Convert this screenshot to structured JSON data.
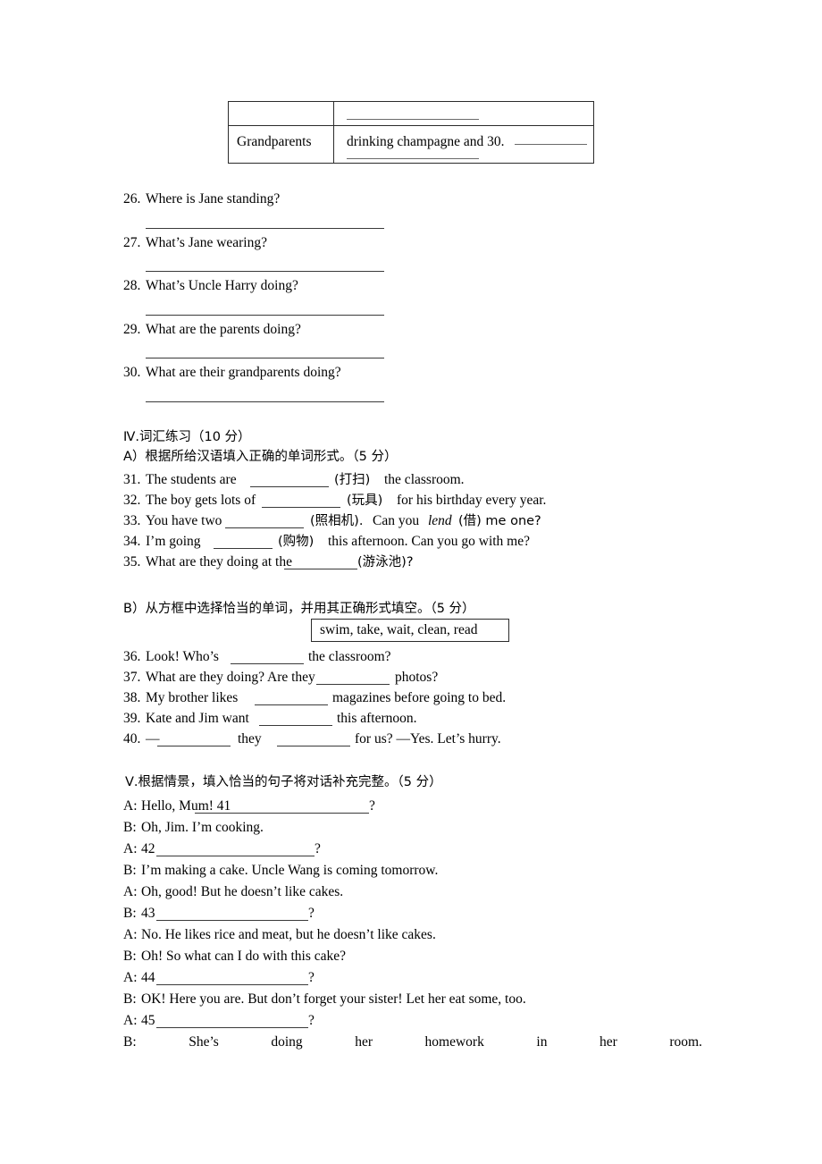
{
  "document": {
    "type": "english-exam-worksheet-page",
    "language": "English / Chinese"
  },
  "table": {
    "rows": [
      {
        "label": "",
        "content": ""
      },
      {
        "label": "Grandparents",
        "content": "drinking champagne and 30."
      }
    ]
  },
  "picture_questions": [
    {
      "number": "26.",
      "text": "Where is Jane standing?"
    },
    {
      "number": "27.",
      "text": "What’s Jane wearing?"
    },
    {
      "number": "28.",
      "text": "What’s Uncle Harry doing?"
    },
    {
      "number": "29.",
      "text": "What are the parents doing?"
    },
    {
      "number": "30.",
      "text": "What are their grandparents doing?"
    }
  ],
  "section_iv": {
    "heading": "Ⅳ.词汇练习（10 分）",
    "part_a": {
      "heading": "A）根据所给汉语填入正确的单词形式。（5 分）",
      "items": [
        {
          "number": "31.",
          "before": "The students are",
          "hint": "(打扫)",
          "after": "the classroom."
        },
        {
          "number": "32.",
          "before": "The boy gets lots of",
          "hint": "(玩具)",
          "after": "for his birthday every year."
        },
        {
          "number": "33.",
          "before": "You have two",
          "hint": "(照相机).",
          "after": "Can you lend(借) me one?"
        },
        {
          "number": "34.",
          "before": "I’m going",
          "hint": "(购物)",
          "after": "this afternoon. Can you go with me?"
        },
        {
          "number": "35.",
          "before": "What are they doing at the",
          "hint": "(游泳池)?",
          "after": ""
        }
      ],
      "q33_parts": {
        "a": "Can you ",
        "b": "lend",
        "c": "(借) me one?"
      }
    },
    "part_b": {
      "heading": "B）从方框中选择恰当的单词，并用其正确形式填空。（5 分）",
      "word_bank": "swim, take, wait, clean, read",
      "items": [
        {
          "number": "36.",
          "before": "Look! Who’s",
          "after": "the classroom?"
        },
        {
          "number": "37.",
          "before": "What are they doing? Are they",
          "after": "photos?"
        },
        {
          "number": "38.",
          "before": "My brother likes",
          "after": "magazines before going to bed."
        },
        {
          "number": "39.",
          "before": "Kate and Jim want",
          "after": "this afternoon."
        },
        {
          "number": "40.",
          "before": "—",
          "middle": "they",
          "after": "for us? —Yes. Let’s hurry."
        }
      ]
    }
  },
  "section_v": {
    "heading": "Ⅴ.根据情景，填入恰当的句子将对话补充完整。（5 分）",
    "lines": [
      {
        "speaker": "A:",
        "text": "Hello, Mum! 41",
        "blank": true,
        "tail": "?"
      },
      {
        "speaker": "B:",
        "text": "Oh, Jim. I’m cooking.",
        "blank": false,
        "tail": ""
      },
      {
        "speaker": "A:",
        "text": "42",
        "blank": true,
        "tail": "?"
      },
      {
        "speaker": "B:",
        "text": "I’m making a cake. Uncle Wang is coming tomorrow.",
        "blank": false,
        "tail": ""
      },
      {
        "speaker": "A:",
        "text": "Oh, good! But he doesn’t like cakes.",
        "blank": false,
        "tail": ""
      },
      {
        "speaker": "B:",
        "text": "43",
        "blank": true,
        "tail": "?"
      },
      {
        "speaker": "A:",
        "text": "No. He likes rice and meat, but he doesn’t like cakes.",
        "blank": false,
        "tail": ""
      },
      {
        "speaker": "B:",
        "text": "Oh! So what can I do with this cake?",
        "blank": false,
        "tail": ""
      },
      {
        "speaker": "A:",
        "text": "44",
        "blank": true,
        "tail": "?"
      },
      {
        "speaker": "B:",
        "text": "OK! Here you are. But don’t forget your sister! Let her eat some, too.",
        "blank": false,
        "tail": ""
      },
      {
        "speaker": "A:",
        "text": "45",
        "blank": true,
        "tail": "?"
      }
    ],
    "final_line_words": [
      "B:",
      "She’s",
      "doing",
      "her",
      "homework",
      "in",
      "her",
      "room."
    ]
  }
}
